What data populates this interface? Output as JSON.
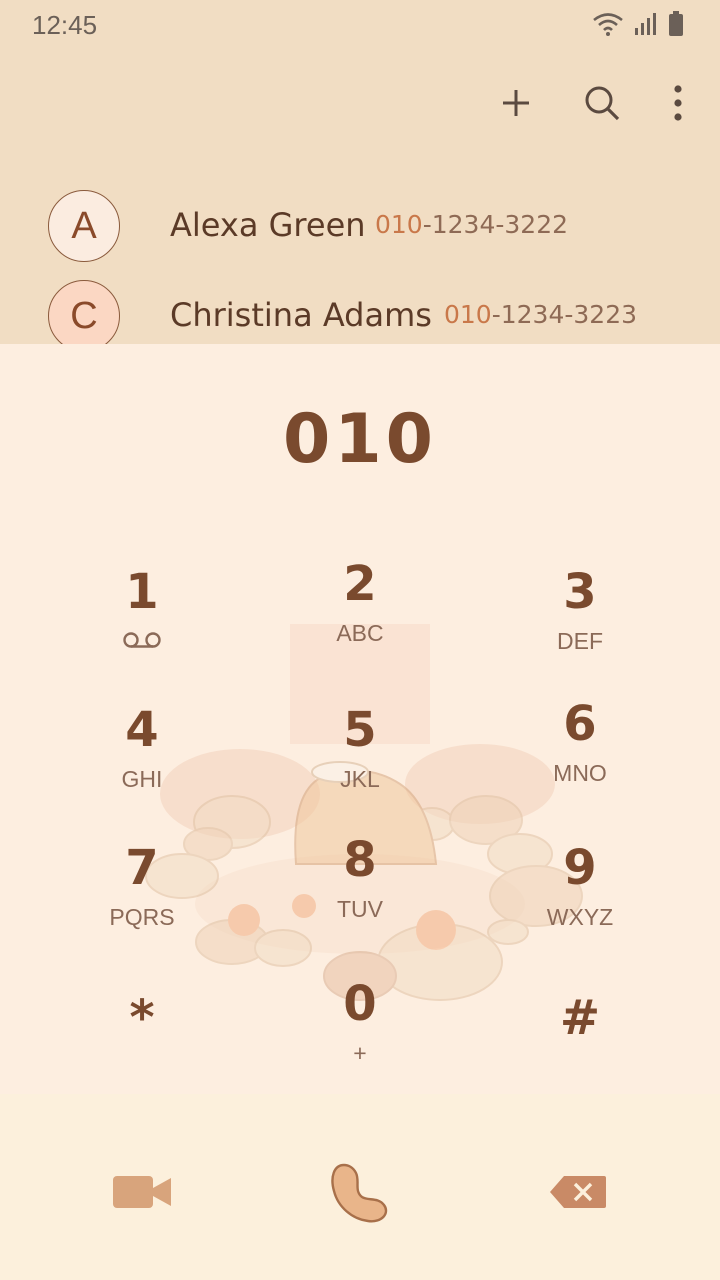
{
  "status_bar": {
    "time": "12:45",
    "icons": [
      "wifi-icon",
      "signal-icon",
      "battery-icon"
    ]
  },
  "action_bar": {
    "icons": [
      "plus-icon",
      "search-icon",
      "more-vert-icon"
    ]
  },
  "contacts": [
    {
      "initial": "A",
      "name": "Alexa Green",
      "number_match": "010",
      "number_rest": "-1234-3222"
    },
    {
      "initial": "C",
      "name": "Christina Adams",
      "number_match": "010",
      "number_rest": "-1234-3223"
    }
  ],
  "dialer": {
    "entered_number": "010",
    "keys": [
      {
        "digit": "1",
        "letters": "",
        "extra_icon": "voicemail-icon"
      },
      {
        "digit": "2",
        "letters": "ABC"
      },
      {
        "digit": "3",
        "letters": "DEF"
      },
      {
        "digit": "4",
        "letters": "GHI"
      },
      {
        "digit": "5",
        "letters": "JKL"
      },
      {
        "digit": "6",
        "letters": "MNO"
      },
      {
        "digit": "7",
        "letters": "PQRS"
      },
      {
        "digit": "8",
        "letters": "TUV"
      },
      {
        "digit": "9",
        "letters": "WXYZ"
      },
      {
        "digit": "*",
        "letters": ""
      },
      {
        "digit": "0",
        "letters": "+"
      },
      {
        "digit": "#",
        "letters": ""
      }
    ]
  },
  "bottom_bar": {
    "icons": [
      "video-call-icon",
      "call-icon",
      "backspace-icon"
    ]
  },
  "colors": {
    "top_background": "#f1ddc3",
    "dialer_background": "#fdeee0",
    "bottom_background": "#fcf0dc",
    "accent_text": "#7a4a2e",
    "number_highlight": "#c9784a"
  }
}
